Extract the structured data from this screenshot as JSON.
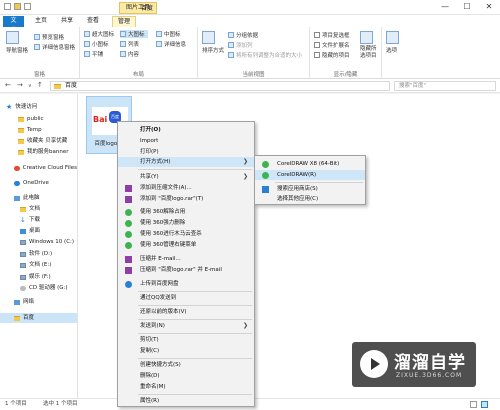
{
  "titlebar": {
    "context_tab": "图片工具",
    "title": "百度",
    "controls": [
      "—",
      "☐",
      "✕"
    ]
  },
  "tabs": {
    "file": "文件",
    "home": "主页",
    "share": "共享",
    "view": "查看",
    "manage": "管理"
  },
  "ribbon": {
    "panes": {
      "nav_pane": "导航窗格",
      "preview": "预览窗格",
      "details": "详细信息窗格",
      "label": "窗格"
    },
    "layout": {
      "items": [
        "超大图标",
        "大图标",
        "中图标",
        "小图标",
        "列表",
        "详细信息",
        "平铺",
        "内容"
      ],
      "label": "布局"
    },
    "sort": {
      "button": "排序方式",
      "group_by": "分组依据",
      "add_columns": "添加列",
      "size_all": "将所有列调整为合适的大小"
    },
    "current_view_label": "当前视图",
    "show_hide": {
      "item_checkboxes": "项目复选框",
      "file_ext": "文件扩展名",
      "hidden_items": "隐藏的项目",
      "hide_selected": "隐藏所选项目",
      "label": "显示/隐藏"
    },
    "options": "选项"
  },
  "address": {
    "path": "百度",
    "search_placeholder": "搜索\"百度\""
  },
  "nav": {
    "items": [
      {
        "label": "快速访问",
        "icon": "star-icon"
      },
      {
        "label": "public",
        "icon": "folder-icon"
      },
      {
        "label": "Temp",
        "icon": "folder-icon"
      },
      {
        "label": "收藏夹 贝享优藏",
        "icon": "folder-icon"
      },
      {
        "label": "我的服务banner",
        "icon": "folder-icon"
      },
      {
        "label": "Creative Cloud Files",
        "icon": "cloud-icon"
      },
      {
        "label": "OneDrive",
        "icon": "cloud-icon"
      },
      {
        "label": "此电脑",
        "icon": "pc-icon"
      },
      {
        "label": "文档",
        "icon": "folder-icon"
      },
      {
        "label": "下载",
        "icon": "download-icon"
      },
      {
        "label": "桌面",
        "icon": "folder-icon"
      },
      {
        "label": "Windows 10 (C:)",
        "icon": "drive-icon"
      },
      {
        "label": "软件 (D:)",
        "icon": "drive-icon"
      },
      {
        "label": "文档 (E:)",
        "icon": "drive-icon"
      },
      {
        "label": "娱乐 (F:)",
        "icon": "drive-icon"
      },
      {
        "label": "CD 驱动器 (G:)",
        "icon": "cd-icon"
      },
      {
        "label": "网络",
        "icon": "network-icon"
      },
      {
        "label": "百度",
        "icon": "folder-icon"
      }
    ]
  },
  "file": {
    "name": "百度logo.jpg",
    "logo_text": "Bai du",
    "logo_badge": "百度"
  },
  "status": {
    "count": "1 个项目",
    "selected": "选中 1 个项目"
  },
  "context_menu": {
    "items": [
      {
        "label": "打开(O)",
        "bold": true
      },
      {
        "label": "Import"
      },
      {
        "label": "打印(P)"
      },
      {
        "label": "打开方式(H)",
        "submenu": true,
        "highlight": true
      },
      {
        "label": "共享(Y)",
        "submenu": true
      },
      {
        "label": "添加到压缩文件(A)...",
        "icon": "winrar-icon"
      },
      {
        "label": "添加到 \"百度logo.rar\"(T)",
        "icon": "winrar-icon"
      },
      {
        "label": "使用 360解除占用",
        "icon": "360-icon"
      },
      {
        "label": "使用 360强力删除",
        "icon": "360-icon"
      },
      {
        "label": "使用 360进行木马云查杀",
        "icon": "360-icon"
      },
      {
        "label": "使用 360管理右键菜单",
        "icon": "360-icon"
      },
      {
        "label": "压缩并 E-mail...",
        "icon": "winrar-icon"
      },
      {
        "label": "压缩到 \"百度logo.rar\" 并 E-mail",
        "icon": "winrar-icon"
      },
      {
        "label": "上传到百度网盘",
        "icon": "baidu-netdisk-icon"
      },
      {
        "label": "通过QQ发送到"
      },
      {
        "label": "还原以前的版本(V)"
      },
      {
        "label": "发送到(N)",
        "submenu": true
      },
      {
        "label": "剪切(T)"
      },
      {
        "label": "复制(C)"
      },
      {
        "label": "创建快捷方式(S)"
      },
      {
        "label": "删除(D)"
      },
      {
        "label": "重命名(M)"
      },
      {
        "label": "属性(R)"
      }
    ]
  },
  "submenu": {
    "items": [
      {
        "label": "CorelDRAW X8 (64-Bit)",
        "icon": "coreldraw-icon"
      },
      {
        "label": "CorelDRAW(R)",
        "icon": "coreldraw-icon",
        "highlight": true
      },
      {
        "label": "搜索应用商店(S)",
        "icon": "store-icon"
      },
      {
        "label": "选择其他应用(C)"
      }
    ]
  },
  "watermark": {
    "title": "溜溜自学",
    "url": "ZIXUE.3D66.COM"
  },
  "colors": {
    "accent": "#1979ca",
    "selection": "#cce4f7",
    "menu_hover": "#cfe6f9"
  }
}
